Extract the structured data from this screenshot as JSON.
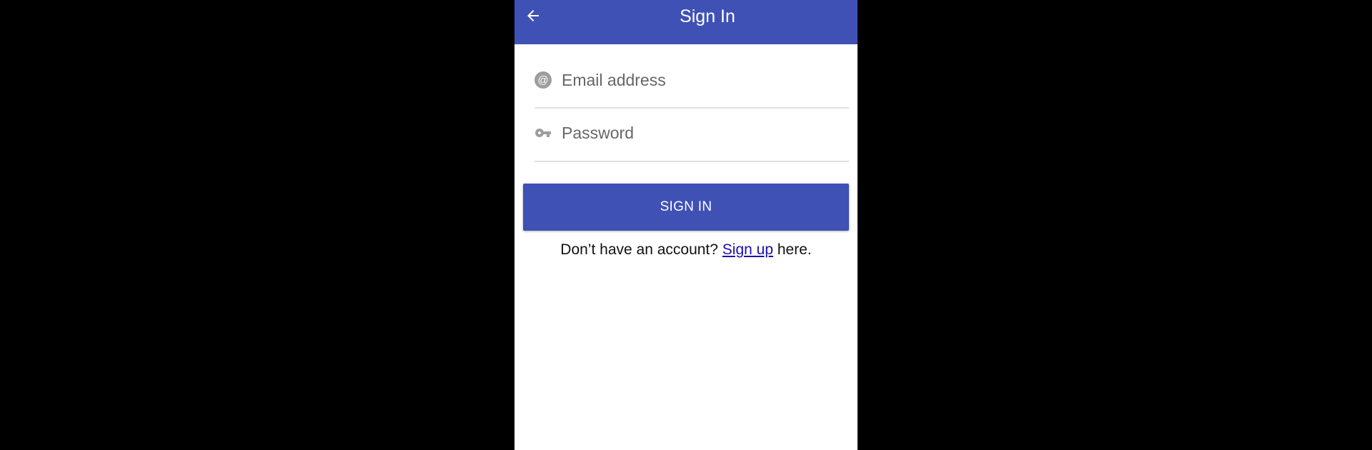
{
  "appbar": {
    "title": "Sign In",
    "back_icon": "arrow-left-icon",
    "color": "#3f51b5"
  },
  "form": {
    "email": {
      "placeholder": "Email address",
      "value": "",
      "icon": "at-sign-icon"
    },
    "password": {
      "placeholder": "Password",
      "value": "",
      "icon": "key-icon"
    },
    "signin_label": "SIGN IN"
  },
  "signup": {
    "prefix": "Don’t have an account? ",
    "link_label": "Sign up",
    "suffix": " here."
  }
}
